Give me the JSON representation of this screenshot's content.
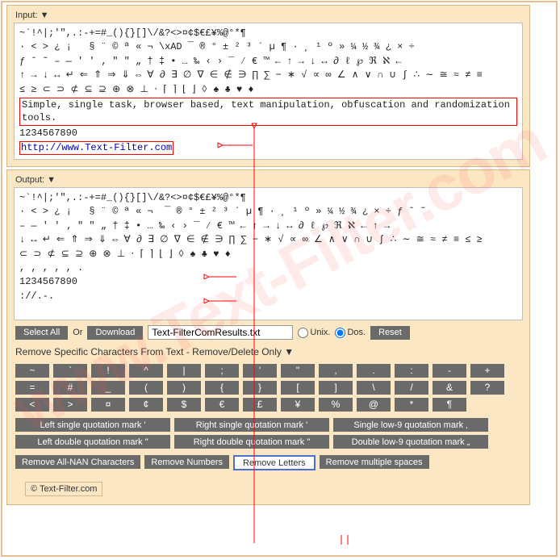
{
  "input": {
    "label": "Input: ▼",
    "chars_line1": "~`!^|;'\",.:-+=#_(){}[]\\/&?<>¤¢$€£¥%@°*¶",
    "chars_line2": "· < > ¿ ¡   § ¨ © ª « ¬ ­\\xAD ¯ ® ° ± ² ³ ´ µ ¶ · ¸ ¹ º » ¼ ½ ¾ ¿ × ÷",
    "chars_line3": "ƒ ˆ ˜ – — ' ' ‚ \" \" „ † ‡ • … ‰ ‹ › ‾ ⁄ € ™ ← ↑ → ↓ ↔ ∂ ℓ ℘ ℜ ℵ ←",
    "chars_line4": "↑ → ↓ ↔ ↵ ⇐ ⇑ ⇒ ⇓ ⇔ ∀ ∂ ∃ ∅ ∇ ∈ ∉ ∋ ∏ ∑ − ∗ √ ∝ ∞ ∠ ∧ ∨ ∩ ∪ ∫ ∴ ∼ ≅ ≈ ≠ ≡",
    "chars_line5": "≤ ≥ ⊂ ⊃ ⊄ ⊆ ⊇ ⊕ ⊗ ⊥ ⋅ ⌈ ⌉ ⌊ ⌋ ◊ ♠ ♣ ♥ ♦",
    "highlight_text": "Simple, single task, browser based, text manipulation, obfuscation and randomization tools.",
    "numbers": "1234567890",
    "url": "http://www.Text-Filter.com"
  },
  "output": {
    "label": "Output: ▼",
    "line1": "~`!^|;'\",.:-+=#_(){}[]\\/&?<>¤¢$€£¥%@°*¶",
    "line2": "· < > ¿ ¡   § ¨ © ª « ¬ ­ ¯ ® ° ± ² ³ ´ µ ¶ · ¸ ¹ º » ¼ ½ ¾ ¿ × ÷ ƒ ˆ ˜",
    "line3": "– — ' ' ‚ \" \" „ † ‡ • … ‰ ‹ › ‾ ⁄ € ™ ← ↑ → ↓ ↔ ∂ ℓ ℘ ℜ ℵ ← ↑ →",
    "line4": "↓ ↔ ↵ ⇐ ⇑ ⇒ ⇓ ⇔ ∀ ∂ ∃ ∅ ∇ ∈ ∉ ∋ ∏ ∑ − ∗ √ ∝ ∞ ∠ ∧ ∨ ∩ ∪ ∫ ∴ ∼ ≅ ≈ ≠ ≡ ≤ ≥",
    "line5": "⊂ ⊃ ⊄ ⊆ ⊇ ⊕ ⊗ ⊥ ⋅ ⌈ ⌉ ⌊ ⌋ ◊ ♠ ♣ ♥ ♦",
    "line6": ", , , , , .",
    "line7": "1234567890",
    "line8": "://.-."
  },
  "controls": {
    "select_all": "Select All",
    "or": "Or",
    "download": "Download",
    "filename": "Text-FilterComResults.txt",
    "unix": "Unix.",
    "dos": "Dos.",
    "reset": "Reset"
  },
  "section_header": "Remove Specific Characters From Text - Remove/Delete Only ▼",
  "char_buttons": [
    "~",
    "`",
    "!",
    "^",
    "|",
    ";",
    "'",
    "\"",
    ",",
    ".",
    ":",
    "-",
    "+",
    "=",
    "#",
    "_",
    "(",
    ")",
    "{",
    "}",
    "[",
    "]",
    "\\",
    "/",
    "&",
    "?",
    "<",
    ">",
    "¤",
    "¢",
    "$",
    "€",
    "£",
    "¥",
    "%",
    "@",
    "*",
    "¶"
  ],
  "quote_buttons": [
    "Left single quotation mark '",
    "Right single quotation mark '",
    "Single low-9 quotation mark ‚",
    "Left double quotation mark \"",
    "Right double quotation mark \"",
    "Double low-9 quotation mark „"
  ],
  "action_buttons": {
    "remove_nan": "Remove All-NAN Characters",
    "remove_numbers": "Remove Numbers",
    "remove_letters": "Remove Letters",
    "remove_spaces": "Remove multiple spaces"
  },
  "copyright": "© Text-Filter.com",
  "watermark": "www.Text-Filter.com"
}
